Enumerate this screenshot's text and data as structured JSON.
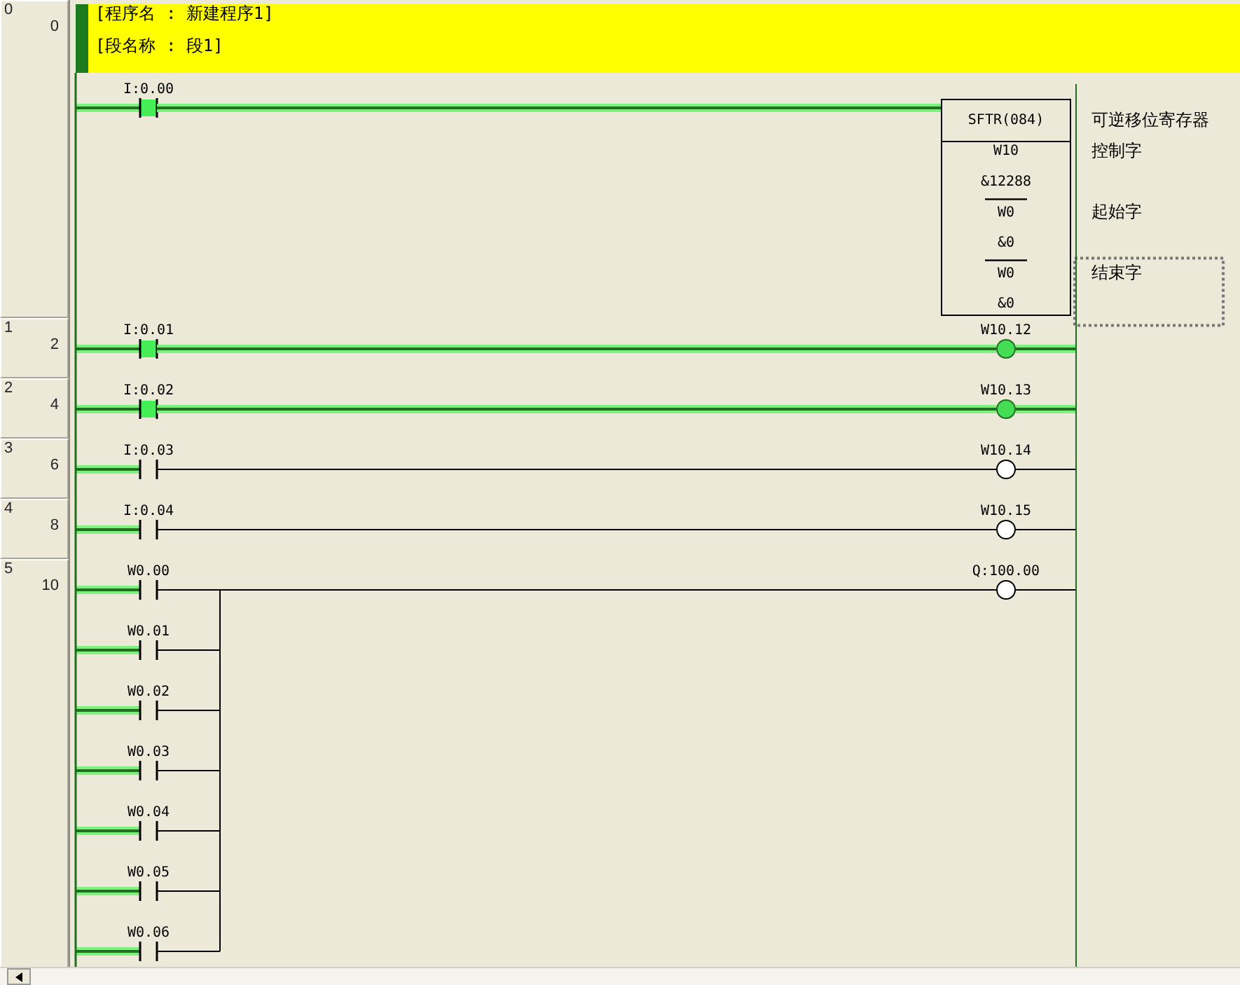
{
  "header": {
    "lines": [
      "[程序名 : 新建程序1]",
      "[段名称 : 段1]"
    ]
  },
  "rungs": [
    {
      "index": "0",
      "step": "0",
      "contacts": [
        {
          "address": "I:0.00",
          "on": true
        }
      ],
      "output": {
        "kind": "block",
        "name": "SFTR(084)",
        "comment": "可逆移位寄存器",
        "rows": [
          {
            "text": "W10",
            "divider": false,
            "comment": "控制字",
            "selected": false
          },
          {
            "text": "&12288",
            "divider": false,
            "selected": false
          },
          {
            "text": "W0",
            "divider": true,
            "comment": "起始字",
            "selected": false
          },
          {
            "text": "&0",
            "divider": false,
            "selected": false
          },
          {
            "text": "W0",
            "divider": true,
            "comment": "结束字",
            "selected": true
          },
          {
            "text": "&0",
            "divider": false,
            "selected": false
          }
        ]
      }
    },
    {
      "index": "1",
      "step": "2",
      "contacts": [
        {
          "address": "I:0.01",
          "on": true
        }
      ],
      "output": {
        "kind": "coil",
        "address": "W10.12",
        "on": true
      }
    },
    {
      "index": "2",
      "step": "4",
      "contacts": [
        {
          "address": "I:0.02",
          "on": true
        }
      ],
      "output": {
        "kind": "coil",
        "address": "W10.13",
        "on": true
      }
    },
    {
      "index": "3",
      "step": "6",
      "contacts": [
        {
          "address": "I:0.03",
          "on": false
        }
      ],
      "output": {
        "kind": "coil",
        "address": "W10.14",
        "on": false
      }
    },
    {
      "index": "4",
      "step": "8",
      "contacts": [
        {
          "address": "I:0.04",
          "on": false
        }
      ],
      "output": {
        "kind": "coil",
        "address": "W10.15",
        "on": false
      }
    },
    {
      "index": "5",
      "step": "10",
      "contacts": [
        {
          "address": "W0.00",
          "on": false
        },
        {
          "address": "W0.01",
          "on": false
        },
        {
          "address": "W0.02",
          "on": false
        },
        {
          "address": "W0.03",
          "on": false
        },
        {
          "address": "W0.04",
          "on": false
        },
        {
          "address": "W0.05",
          "on": false
        },
        {
          "address": "W0.06",
          "on": false
        }
      ],
      "output": {
        "kind": "coil",
        "address": "Q:100.00",
        "on": false
      }
    }
  ]
}
